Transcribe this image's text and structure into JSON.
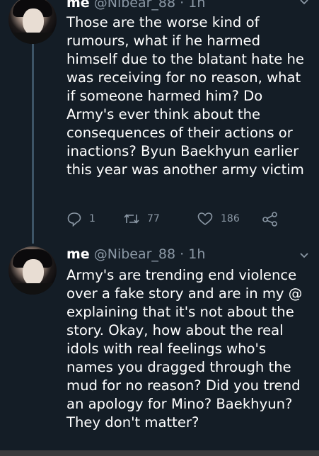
{
  "tweets": [
    {
      "name": "me",
      "handle": "@Nibear_88",
      "dot": "·",
      "time": "1h",
      "text": "Those are the worse kind of\nrumours, what if he harmed\nhimself due to the blatant hate he\nwas receiving for no reason, what\nif someone harmed him? Do\nArmy's ever think about the\nconsequences of their actions or\ninactions? Byun Baekhyun earlier\nthis year was another army victim",
      "replies": "1",
      "retweets": "77",
      "likes": "186"
    },
    {
      "name": "me",
      "handle": "@Nibear_88",
      "dot": "·",
      "time": "1h",
      "text": "Army's are trending end violence\nover a fake story and are in my @\nexplaining that it's not about the\nstory. Okay, how about the real\nidols with real feelings who's\nnames you dragged through the\nmud for no reason? Did you trend\nan apology for Mino? Baekhyun?\nThey don't matter?"
    }
  ],
  "colors": {
    "background": "#141d26",
    "secondary_text": "#8b98a5",
    "thread_line": "#3d5466"
  },
  "icons": [
    "reply-icon",
    "retweet-icon",
    "like-icon",
    "share-icon",
    "chevron-down-icon"
  ]
}
